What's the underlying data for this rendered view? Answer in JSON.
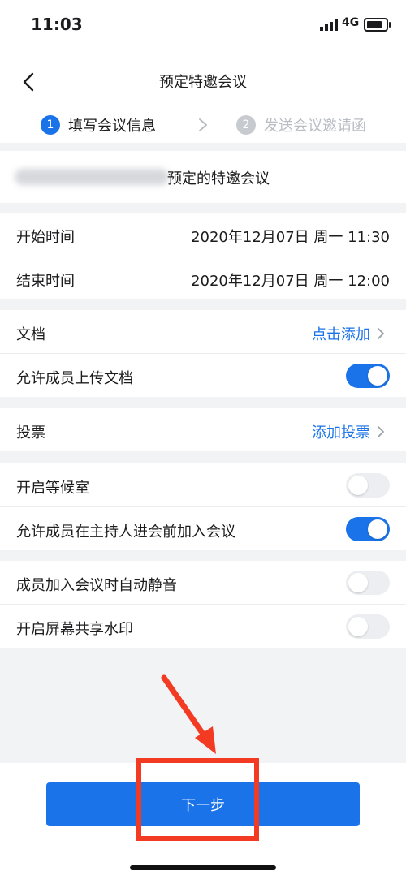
{
  "status_bar": {
    "time": "11:03",
    "network": "4G"
  },
  "nav": {
    "title": "预定特邀会议"
  },
  "steps": [
    {
      "number": "1",
      "label": "填写会议信息"
    },
    {
      "number": "2",
      "label": "发送会议邀请函"
    }
  ],
  "meeting": {
    "name_suffix": "预定的特邀会议"
  },
  "time_section": {
    "start_label": "开始时间",
    "start_value": "2020年12月07日  周一  11:30",
    "end_label": "结束时间",
    "end_value": "2020年12月07日  周一  12:00"
  },
  "docs_section": {
    "docs_label": "文档",
    "docs_action": "点击添加",
    "upload_label": "允许成员上传文档",
    "upload_on": true
  },
  "vote_section": {
    "vote_label": "投票",
    "vote_action": "添加投票"
  },
  "waiting_section": {
    "waiting_label": "开启等候室",
    "waiting_on": false,
    "join_before_label": "允许成员在主持人进会前加入会议",
    "join_before_on": true
  },
  "other_section": {
    "mute_label": "成员加入会议时自动静音",
    "mute_on": false,
    "watermark_label": "开启屏幕共享水印",
    "watermark_on": false
  },
  "footer": {
    "next_label": "下一步"
  },
  "colors": {
    "accent": "#1a73e8",
    "highlight": "#f33b24"
  }
}
